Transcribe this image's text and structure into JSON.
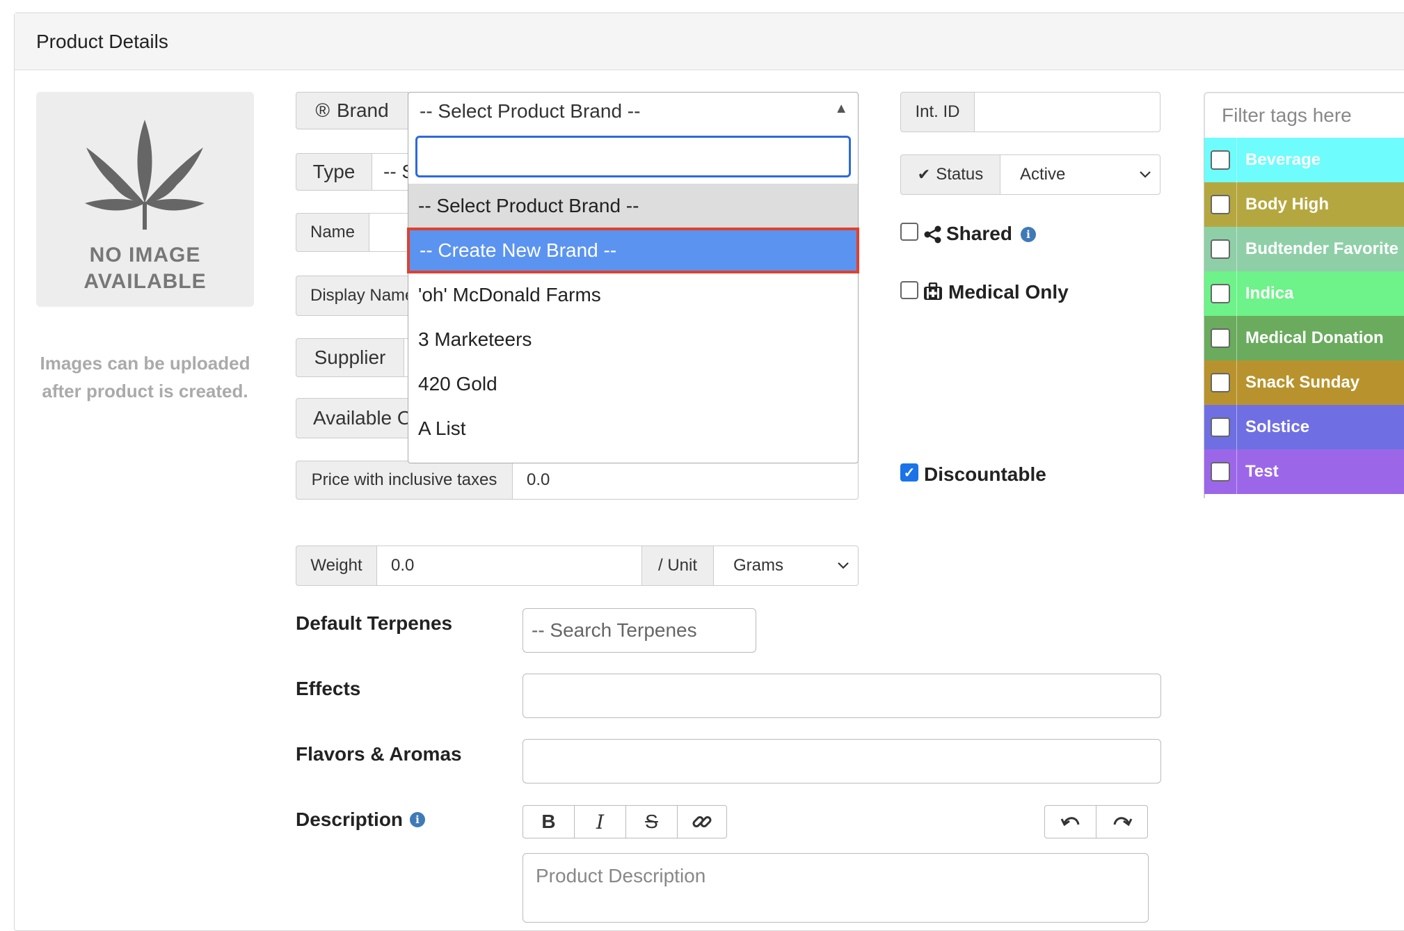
{
  "panel": {
    "title": "Product Details"
  },
  "image": {
    "placeholder_line1": "NO IMAGE",
    "placeholder_line2": "AVAILABLE",
    "note": "Images can be uploaded after product is created."
  },
  "form": {
    "brand_label": "Brand",
    "brand_value": "-- Select Product Brand --",
    "type_label": "Type",
    "type_value": "-- S",
    "name_label": "Name",
    "display_name_label": "Display Name",
    "supplier_label": "Supplier",
    "available_label": "Available O",
    "price_label": "Price with inclusive taxes",
    "price_value": "0.0",
    "weight_label": "Weight",
    "weight_value": "0.0",
    "unit_label": "/ Unit",
    "unit_value": "Grams"
  },
  "brand_dropdown": {
    "search_value": "",
    "options": [
      "-- Select Product Brand --",
      "-- Create New Brand --",
      "'oh' McDonald Farms",
      "3 Marketeers",
      "420 Gold",
      "A List"
    ],
    "highlighted_index": 1
  },
  "right": {
    "int_id_label": "Int. ID",
    "int_id_value": "",
    "status_label": "Status",
    "status_value": "Active",
    "shared_label": "Shared",
    "medical_label": "Medical Only",
    "discountable_label": "Discountable",
    "discountable_checked": true
  },
  "tags": {
    "filter_placeholder": "Filter tags here",
    "items": [
      {
        "name": "Beverage",
        "color": "#6efcfc"
      },
      {
        "name": "Body High",
        "color": "#b5a73f"
      },
      {
        "name": "Budtender Favorite",
        "color": "#8fcfa8"
      },
      {
        "name": "Indica",
        "color": "#6ef28a"
      },
      {
        "name": "Medical Donation",
        "color": "#6aab5e"
      },
      {
        "name": "Snack Sunday",
        "color": "#b8932d"
      },
      {
        "name": "Solstice",
        "color": "#6f6fe3"
      },
      {
        "name": "Test",
        "color": "#9b67e8"
      }
    ]
  },
  "sections": {
    "terpenes_label": "Default Terpenes",
    "terpenes_placeholder": "-- Search Terpenes",
    "effects_label": "Effects",
    "flavors_label": "Flavors & Aromas",
    "description_label": "Description",
    "description_placeholder": "Product Description"
  },
  "icons": {
    "brand": "registered-icon",
    "status": "check-icon",
    "shared": "share-icon",
    "medical": "medkit-icon",
    "info": "info-icon",
    "bold": "bold-icon",
    "italic": "italic-icon",
    "strike": "strikethrough-icon",
    "link": "link-icon",
    "undo": "undo-icon",
    "redo": "redo-icon"
  }
}
